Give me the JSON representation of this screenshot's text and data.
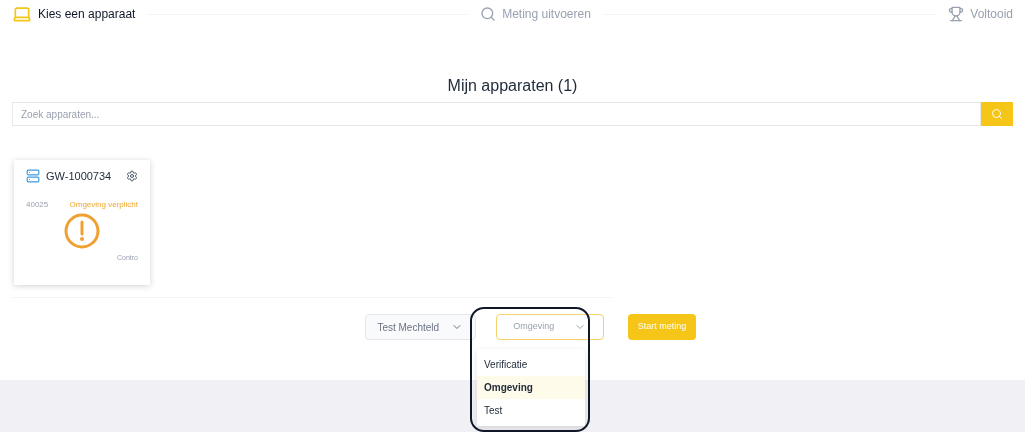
{
  "steps": [
    {
      "label": "Kies een apparaat",
      "kind": "laptop",
      "selected": true
    },
    {
      "label": "Meting uitvoeren",
      "kind": "search",
      "selected": false
    },
    {
      "label": "Voltooid",
      "kind": "trophy",
      "selected": false
    }
  ],
  "title": "Mijn apparaten (1)",
  "search": {
    "placeholder": "Zoek apparaten..."
  },
  "devices": [
    {
      "name": "GW-1000734",
      "code": "40025",
      "status": "Omgeving verplicht",
      "action": "Contro"
    }
  ],
  "controls": {
    "user": "Test Mechteld",
    "type": "Omgeving",
    "start": "Start meting"
  },
  "dropdown": {
    "options": [
      {
        "label": "Verificatie",
        "selected": false
      },
      {
        "label": "Omgeving",
        "selected": true
      },
      {
        "label": "Test",
        "selected": false
      }
    ]
  }
}
